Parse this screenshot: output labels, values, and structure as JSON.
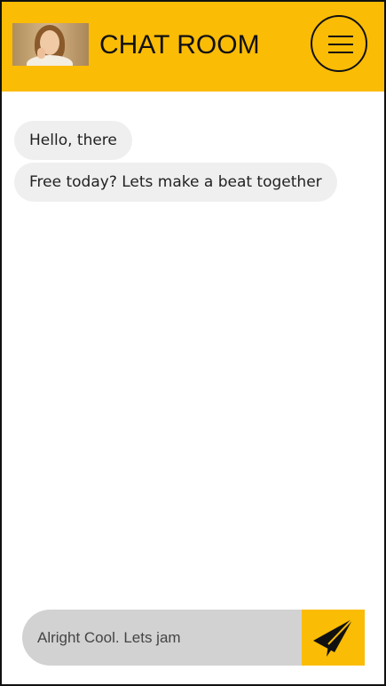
{
  "header": {
    "title": "CHAT ROOM",
    "background_color": "#FBBC05",
    "avatar_icon": "user-avatar-photo",
    "menu_icon": "hamburger-menu-icon"
  },
  "messages": [
    {
      "text": "Hello, there"
    },
    {
      "text": "Free today? Lets make a beat together"
    }
  ],
  "composer": {
    "value": "Alright Cool. Lets jam",
    "send_icon": "paper-plane-icon",
    "send_color": "#FBBC05"
  }
}
